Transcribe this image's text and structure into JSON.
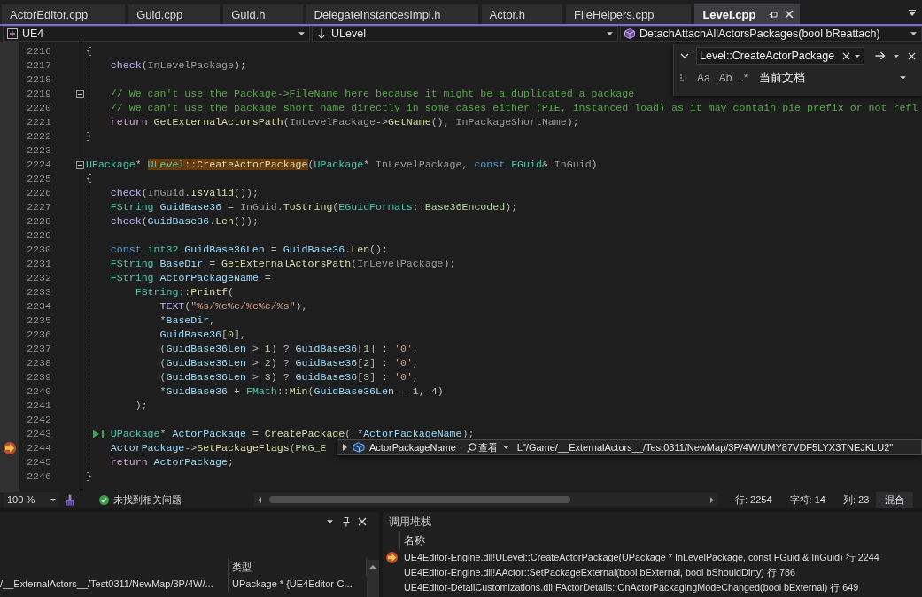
{
  "tabs": [
    {
      "label": "ActorEditor.cpp",
      "selected": false
    },
    {
      "label": "Guid.cpp",
      "selected": false
    },
    {
      "label": "Guid.h",
      "selected": false
    },
    {
      "label": "DelegateInstancesImpl.h",
      "selected": false
    },
    {
      "label": "Actor.h",
      "selected": false
    },
    {
      "label": "FileHelpers.cpp",
      "selected": false
    },
    {
      "label": "Level.cpp",
      "selected": true
    }
  ],
  "navigation_bar": {
    "project": "UE4",
    "scope": "ULevel",
    "member": "DetachAttachAllActorsPackages(bool bReattach)"
  },
  "editor": {
    "lines": [
      {
        "number": "2216",
        "fold": false,
        "current": false,
        "run_to_click": false,
        "code": [
          {
            "kind": "op",
            "text": "{"
          }
        ]
      },
      {
        "number": "2217",
        "fold": false,
        "current": false,
        "run_to_click": false,
        "code": [
          {
            "kind": "macro",
            "text": "    check"
          },
          {
            "kind": "op",
            "text": "("
          },
          {
            "kind": "param",
            "text": "InLevelPackage"
          },
          {
            "kind": "op",
            "text": ");"
          }
        ]
      },
      {
        "number": "2218",
        "fold": false,
        "current": false,
        "run_to_click": false
      },
      {
        "number": "2219",
        "fold": true,
        "current": false,
        "run_to_click": false,
        "code": [
          {
            "kind": "comment",
            "text": "    // We can't use the Package->FileName here because it might be a duplicated a package"
          }
        ]
      },
      {
        "number": "2220",
        "fold": false,
        "current": false,
        "run_to_click": false,
        "code": [
          {
            "kind": "comment",
            "text": "    // We can't use the package short name directly in some cases either (PIE, instanced load) as it may contain pie prefix or not refl"
          }
        ]
      },
      {
        "number": "2221",
        "fold": false,
        "current": false,
        "run_to_click": false,
        "code": [
          {
            "kind": "control",
            "text": "    return "
          },
          {
            "kind": "function",
            "text": "GetExternalActorsPath"
          },
          {
            "kind": "op",
            "text": "("
          },
          {
            "kind": "param",
            "text": "InLevelPackage"
          },
          {
            "kind": "op",
            "text": "->"
          },
          {
            "kind": "function",
            "text": "GetName"
          },
          {
            "kind": "op",
            "text": "(), "
          },
          {
            "kind": "param",
            "text": "InPackageShortName"
          },
          {
            "kind": "op",
            "text": ");"
          }
        ]
      },
      {
        "number": "2222",
        "fold": false,
        "current": false,
        "run_to_click": false,
        "code": [
          {
            "kind": "op",
            "text": "}"
          }
        ]
      },
      {
        "number": "2223",
        "fold": false,
        "current": false,
        "run_to_click": false
      },
      {
        "number": "2224",
        "fold": true,
        "current": false,
        "run_to_click": false,
        "code": [
          {
            "kind": "type",
            "text": "UPackage"
          },
          {
            "kind": "op",
            "text": "* "
          },
          {
            "kind": "match",
            "parts": [
              {
                "kind": "type",
                "text": "ULevel"
              },
              {
                "kind": "op",
                "text": "::"
              },
              {
                "kind": "function",
                "text": "CreateActorPackage"
              }
            ]
          },
          {
            "kind": "op",
            "text": "("
          },
          {
            "kind": "type",
            "text": "UPackage"
          },
          {
            "kind": "op",
            "text": "* "
          },
          {
            "kind": "param",
            "text": "InLevelPackage"
          },
          {
            "kind": "op",
            "text": ", "
          },
          {
            "kind": "keyword",
            "text": "const "
          },
          {
            "kind": "type",
            "text": "FGuid"
          },
          {
            "kind": "op",
            "text": "& "
          },
          {
            "kind": "param",
            "text": "InGuid"
          },
          {
            "kind": "op",
            "text": ")"
          }
        ]
      },
      {
        "number": "2225",
        "fold": false,
        "current": false,
        "run_to_click": false,
        "code": [
          {
            "kind": "op",
            "text": "{"
          }
        ]
      },
      {
        "number": "2226",
        "fold": false,
        "current": false,
        "run_to_click": false,
        "code": [
          {
            "kind": "macro",
            "text": "    check"
          },
          {
            "kind": "op",
            "text": "("
          },
          {
            "kind": "param",
            "text": "InGuid"
          },
          {
            "kind": "op",
            "text": "."
          },
          {
            "kind": "function",
            "text": "IsValid"
          },
          {
            "kind": "op",
            "text": "());"
          }
        ]
      },
      {
        "number": "2227",
        "fold": false,
        "current": false,
        "run_to_click": false,
        "code": [
          {
            "kind": "type",
            "text": "    FString "
          },
          {
            "kind": "variable",
            "text": "GuidBase36"
          },
          {
            "kind": "op",
            "text": " = "
          },
          {
            "kind": "param",
            "text": "InGuid"
          },
          {
            "kind": "op",
            "text": "."
          },
          {
            "kind": "function",
            "text": "ToString"
          },
          {
            "kind": "op",
            "text": "("
          },
          {
            "kind": "type",
            "text": "EGuidFormats"
          },
          {
            "kind": "op",
            "text": "::"
          },
          {
            "kind": "enum",
            "text": "Base36Encoded"
          },
          {
            "kind": "op",
            "text": ");"
          }
        ]
      },
      {
        "number": "2228",
        "fold": false,
        "current": false,
        "run_to_click": false,
        "code": [
          {
            "kind": "macro",
            "text": "    check"
          },
          {
            "kind": "op",
            "text": "("
          },
          {
            "kind": "variable",
            "text": "GuidBase36"
          },
          {
            "kind": "op",
            "text": "."
          },
          {
            "kind": "function",
            "text": "Len"
          },
          {
            "kind": "op",
            "text": "());"
          }
        ]
      },
      {
        "number": "2229",
        "fold": false,
        "current": false,
        "run_to_click": false
      },
      {
        "number": "2230",
        "fold": false,
        "current": false,
        "run_to_click": false,
        "code": [
          {
            "kind": "keyword",
            "text": "    const "
          },
          {
            "kind": "type",
            "text": "int32 "
          },
          {
            "kind": "variable",
            "text": "GuidBase36Len"
          },
          {
            "kind": "op",
            "text": " = "
          },
          {
            "kind": "variable",
            "text": "GuidBase36"
          },
          {
            "kind": "op",
            "text": "."
          },
          {
            "kind": "function",
            "text": "Len"
          },
          {
            "kind": "op",
            "text": "();"
          }
        ]
      },
      {
        "number": "2231",
        "fold": false,
        "current": false,
        "run_to_click": false,
        "code": [
          {
            "kind": "type",
            "text": "    FString "
          },
          {
            "kind": "variable",
            "text": "BaseDir"
          },
          {
            "kind": "op",
            "text": " = "
          },
          {
            "kind": "function",
            "text": "GetExternalActorsPath"
          },
          {
            "kind": "op",
            "text": "("
          },
          {
            "kind": "param",
            "text": "InLevelPackage"
          },
          {
            "kind": "op",
            "text": ");"
          }
        ]
      },
      {
        "number": "2232",
        "fold": false,
        "current": false,
        "run_to_click": false,
        "code": [
          {
            "kind": "type",
            "text": "    FString "
          },
          {
            "kind": "variable",
            "text": "ActorPackageName"
          },
          {
            "kind": "op",
            "text": " ="
          }
        ]
      },
      {
        "number": "2233",
        "fold": false,
        "current": false,
        "run_to_click": false,
        "code": [
          {
            "kind": "type",
            "text": "        FString"
          },
          {
            "kind": "op",
            "text": "::"
          },
          {
            "kind": "function",
            "text": "Printf"
          },
          {
            "kind": "op",
            "text": "("
          }
        ]
      },
      {
        "number": "2234",
        "fold": false,
        "current": false,
        "run_to_click": false,
        "code": [
          {
            "kind": "macro",
            "text": "            TEXT"
          },
          {
            "kind": "op",
            "text": "("
          },
          {
            "kind": "string",
            "text": "\"%s/%c%c/%c%c/%s\""
          },
          {
            "kind": "op",
            "text": "),"
          }
        ]
      },
      {
        "number": "2235",
        "fold": false,
        "current": false,
        "run_to_click": false,
        "code": [
          {
            "kind": "op",
            "text": "            *"
          },
          {
            "kind": "variable",
            "text": "BaseDir"
          },
          {
            "kind": "op",
            "text": ","
          }
        ]
      },
      {
        "number": "2236",
        "fold": false,
        "current": false,
        "run_to_click": false,
        "code": [
          {
            "kind": "variable",
            "text": "            GuidBase36"
          },
          {
            "kind": "op",
            "text": "["
          },
          {
            "kind": "number",
            "text": "0"
          },
          {
            "kind": "op",
            "text": "],"
          }
        ]
      },
      {
        "number": "2237",
        "fold": false,
        "current": false,
        "run_to_click": false,
        "code": [
          {
            "kind": "op",
            "text": "            ("
          },
          {
            "kind": "variable",
            "text": "GuidBase36Len"
          },
          {
            "kind": "op",
            "text": " > "
          },
          {
            "kind": "number",
            "text": "1"
          },
          {
            "kind": "op",
            "text": ") ? "
          },
          {
            "kind": "variable",
            "text": "GuidBase36"
          },
          {
            "kind": "op",
            "text": "["
          },
          {
            "kind": "number",
            "text": "1"
          },
          {
            "kind": "op",
            "text": "] : "
          },
          {
            "kind": "string",
            "text": "'0'"
          },
          {
            "kind": "op",
            "text": ","
          }
        ]
      },
      {
        "number": "2238",
        "fold": false,
        "current": false,
        "run_to_click": false,
        "code": [
          {
            "kind": "op",
            "text": "            ("
          },
          {
            "kind": "variable",
            "text": "GuidBase36Len"
          },
          {
            "kind": "op",
            "text": " > "
          },
          {
            "kind": "number",
            "text": "2"
          },
          {
            "kind": "op",
            "text": ") ? "
          },
          {
            "kind": "variable",
            "text": "GuidBase36"
          },
          {
            "kind": "op",
            "text": "["
          },
          {
            "kind": "number",
            "text": "2"
          },
          {
            "kind": "op",
            "text": "] : "
          },
          {
            "kind": "string",
            "text": "'0'"
          },
          {
            "kind": "op",
            "text": ","
          }
        ]
      },
      {
        "number": "2239",
        "fold": false,
        "current": false,
        "run_to_click": false,
        "code": [
          {
            "kind": "op",
            "text": "            ("
          },
          {
            "kind": "variable",
            "text": "GuidBase36Len"
          },
          {
            "kind": "op",
            "text": " > "
          },
          {
            "kind": "number",
            "text": "3"
          },
          {
            "kind": "op",
            "text": ") ? "
          },
          {
            "kind": "variable",
            "text": "GuidBase36"
          },
          {
            "kind": "op",
            "text": "["
          },
          {
            "kind": "number",
            "text": "3"
          },
          {
            "kind": "op",
            "text": "] : "
          },
          {
            "kind": "string",
            "text": "'0'"
          },
          {
            "kind": "op",
            "text": ","
          }
        ]
      },
      {
        "number": "2240",
        "fold": false,
        "current": false,
        "run_to_click": false,
        "code": [
          {
            "kind": "op",
            "text": "            *"
          },
          {
            "kind": "variable",
            "text": "GuidBase36"
          },
          {
            "kind": "op",
            "text": " + "
          },
          {
            "kind": "type",
            "text": "FMath"
          },
          {
            "kind": "op",
            "text": "::"
          },
          {
            "kind": "function",
            "text": "Min"
          },
          {
            "kind": "op",
            "text": "("
          },
          {
            "kind": "variable",
            "text": "GuidBase36Len"
          },
          {
            "kind": "op",
            "text": " - "
          },
          {
            "kind": "number",
            "text": "1"
          },
          {
            "kind": "op",
            "text": ", "
          },
          {
            "kind": "number",
            "text": "4"
          },
          {
            "kind": "op",
            "text": ")"
          }
        ]
      },
      {
        "number": "2241",
        "fold": false,
        "current": false,
        "run_to_click": false,
        "code": [
          {
            "kind": "op",
            "text": "        );"
          }
        ]
      },
      {
        "number": "2242",
        "fold": false,
        "current": false,
        "run_to_click": false
      },
      {
        "number": "2243",
        "fold": false,
        "current": false,
        "run_to_click": true,
        "code": [
          {
            "kind": "type",
            "text": "    UPackage"
          },
          {
            "kind": "op",
            "text": "* "
          },
          {
            "kind": "variable",
            "text": "ActorPackage"
          },
          {
            "kind": "op",
            "text": " = "
          },
          {
            "kind": "function",
            "text": "CreatePackage"
          },
          {
            "kind": "op",
            "text": "( *"
          },
          {
            "kind": "variable",
            "text": "ActorPackageName"
          },
          {
            "kind": "op",
            "text": ");"
          }
        ]
      },
      {
        "number": "2244",
        "fold": false,
        "current": true,
        "run_to_click": false,
        "code": [
          {
            "kind": "variable",
            "text": "    ActorPackage"
          },
          {
            "kind": "op",
            "text": "->"
          },
          {
            "kind": "function",
            "text": "SetPackageFlags"
          },
          {
            "kind": "op",
            "text": "("
          },
          {
            "kind": "enum",
            "text": "PKG_E"
          }
        ]
      },
      {
        "number": "2245",
        "fold": false,
        "current": false,
        "run_to_click": false,
        "code": [
          {
            "kind": "control",
            "text": "    return "
          },
          {
            "kind": "variable",
            "text": "ActorPackage"
          },
          {
            "kind": "op",
            "text": ";"
          }
        ]
      },
      {
        "number": "2246",
        "fold": false,
        "current": false,
        "run_to_click": false,
        "code": [
          {
            "kind": "op",
            "text": "}"
          }
        ]
      }
    ],
    "find": {
      "query": "Level::CreateActorPackage",
      "options": [
        {
          "label": "Aa",
          "on": false
        },
        {
          "label": "Ab",
          "on": false
        },
        {
          "label": ".*",
          "on": false
        }
      ],
      "scope": "当前文档"
    },
    "data_tip": {
      "name": "ActorPackageName",
      "visualizer": "查看",
      "value": "L\"/Game/__ExternalActors__/Test0311/NewMap/3P/4W/UMY87VDF5LYX3TNEJKLU2\""
    }
  },
  "editor_status": {
    "zoom": "100 %",
    "issues": "未找到相关问题",
    "line": "行: 2254",
    "character": "字符: 14",
    "column": "列: 23",
    "line_endings": "混合"
  },
  "watch_panel": {
    "columns": [
      "类型"
    ],
    "rows": [
      {
        "column_1": "/__ExternalActors__/Test0311/NewMap/3P/4W/...",
        "type": "UPackage * {UE4Editor-C..."
      }
    ]
  },
  "call_stack": {
    "title": "调用堆栈",
    "columns": [
      "名称"
    ],
    "rows": [
      {
        "text": "UE4Editor-Engine.dll!ULevel::CreateActorPackage(UPackage * InLevelPackage, const FGuid & InGuid) 行 2244",
        "current": true
      },
      {
        "text": "UE4Editor-Engine.dll!AActor::SetPackageExternal(bool bExternal, bool bShouldDirty) 行 786",
        "current": false
      },
      {
        "text": "UE4Editor-DetailCustomizations.dll!FActorDetails::OnActorPackagingModeChanged(bool bExternal) 行 649",
        "current": false
      }
    ]
  }
}
